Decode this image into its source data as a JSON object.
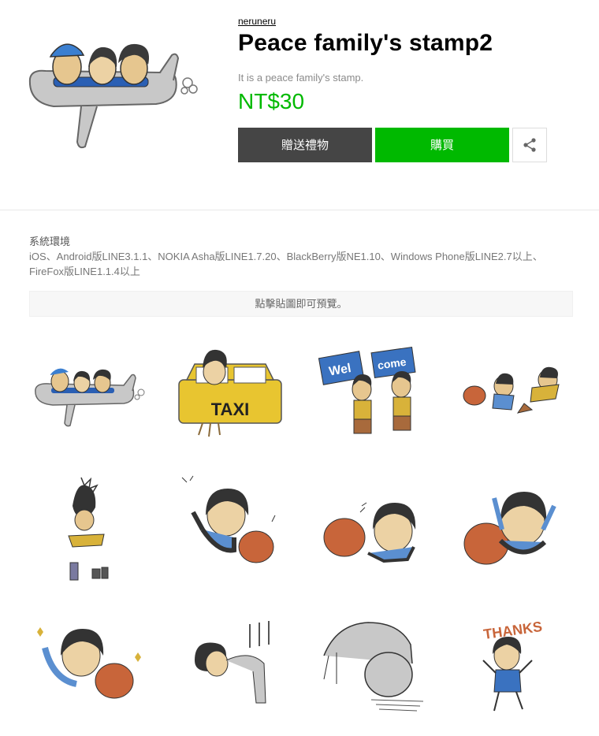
{
  "product": {
    "author": "neruneru",
    "title": "Peace family's stamp2",
    "description": "It is a peace family's stamp.",
    "price": "NT$30"
  },
  "actions": {
    "gift_label": "贈送禮物",
    "buy_label": "購買",
    "share_icon": "share-icon"
  },
  "environment": {
    "label": "系統環境",
    "text": "iOS、Android版LINE3.1.1、NOKIA Asha版LINE1.7.20、BlackBerry版NE1.10、Windows Phone版LINE2.7以上、FireFox版LINE1.1.4以上"
  },
  "preview_hint": "點擊貼圖即可預覽。",
  "stamps": [
    {
      "name": "airplane",
      "text": ""
    },
    {
      "name": "taxi",
      "text": "TAXI"
    },
    {
      "name": "welcome-signs",
      "text": "Wel",
      "text2": "come"
    },
    {
      "name": "flying-family",
      "text": ""
    },
    {
      "name": "explosion-jump",
      "text": ""
    },
    {
      "name": "girl-with-dog",
      "text": ""
    },
    {
      "name": "high-five-dog",
      "text": ""
    },
    {
      "name": "cheer-with-dog",
      "text": ""
    },
    {
      "name": "sparkle-with-dog",
      "text": ""
    },
    {
      "name": "bowing-person",
      "text": ""
    },
    {
      "name": "grey-dog",
      "text": ""
    },
    {
      "name": "thanks-girl",
      "text": "THANKS"
    }
  ],
  "colors": {
    "buy_green": "#00b900",
    "gift_dark": "#454545",
    "price_green": "#00b900"
  }
}
